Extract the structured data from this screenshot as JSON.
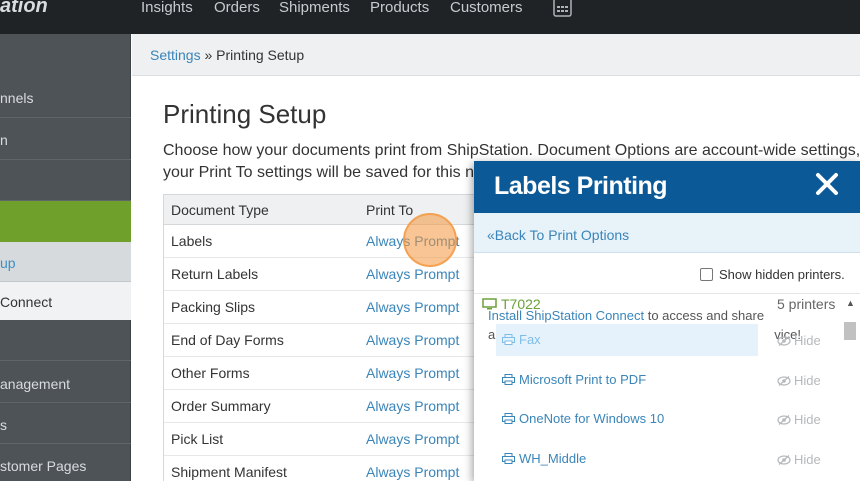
{
  "topnav": {
    "logo": "ation",
    "items": [
      "Insights",
      "Orders",
      "Shipments",
      "Products",
      "Customers"
    ]
  },
  "sidebar": {
    "items": [
      {
        "label": "nnels"
      },
      {
        "label": "n"
      },
      {
        "label": ""
      },
      {
        "label": ""
      },
      {
        "label": "up"
      },
      {
        "label": "Connect"
      },
      {
        "label": ""
      },
      {
        "label": "anagement"
      },
      {
        "label": "s"
      },
      {
        "label": "stomer Pages"
      }
    ]
  },
  "breadcrumb": {
    "parent": "Settings",
    "separator": " » ",
    "current": "Printing Setup"
  },
  "page": {
    "title": "Printing Setup",
    "description_line1": "Choose how your documents print from ShipStation. Document Options are account-wide settings,",
    "description_line2": "your Print To settings will be saved for this n"
  },
  "doc_table": {
    "headers": {
      "type": "Document Type",
      "print_to": "Print To"
    },
    "rows": [
      {
        "type": "Labels",
        "print_to": "Always Prompt"
      },
      {
        "type": "Return Labels",
        "print_to": "Always Prompt"
      },
      {
        "type": "Packing Slips",
        "print_to": "Always Prompt"
      },
      {
        "type": "End of Day Forms",
        "print_to": "Always Prompt"
      },
      {
        "type": "Other Forms",
        "print_to": "Always Prompt"
      },
      {
        "type": "Order Summary",
        "print_to": "Always Prompt"
      },
      {
        "type": "Pick List",
        "print_to": "Always Prompt"
      },
      {
        "type": "Shipment Manifest",
        "print_to": "Always Prompt"
      }
    ]
  },
  "modal": {
    "title": "Labels Printing",
    "back_link": "«Back To Print Options",
    "show_hidden_label": "Show hidden printers.",
    "group_name": "T7022",
    "printer_count": "5 printers",
    "connect_note_link": "Install ShipStation Connect",
    "connect_note_text": " to access and share",
    "connect_note_line2_start": "a",
    "connect_note_line2_end": "vice!",
    "hide_label": "Hide",
    "printers": [
      {
        "name": "Fax",
        "selected": true
      },
      {
        "name": "Microsoft Print to PDF",
        "selected": false
      },
      {
        "name": "OneNote for Windows 10",
        "selected": false
      },
      {
        "name": "WH_Middle",
        "selected": false
      }
    ]
  },
  "colors": {
    "topbar": "#1f2326",
    "sidebar": "#4d5357",
    "accent_green": "#70a02c",
    "modal_header": "#0b5a97",
    "link": "#3a85b9"
  }
}
